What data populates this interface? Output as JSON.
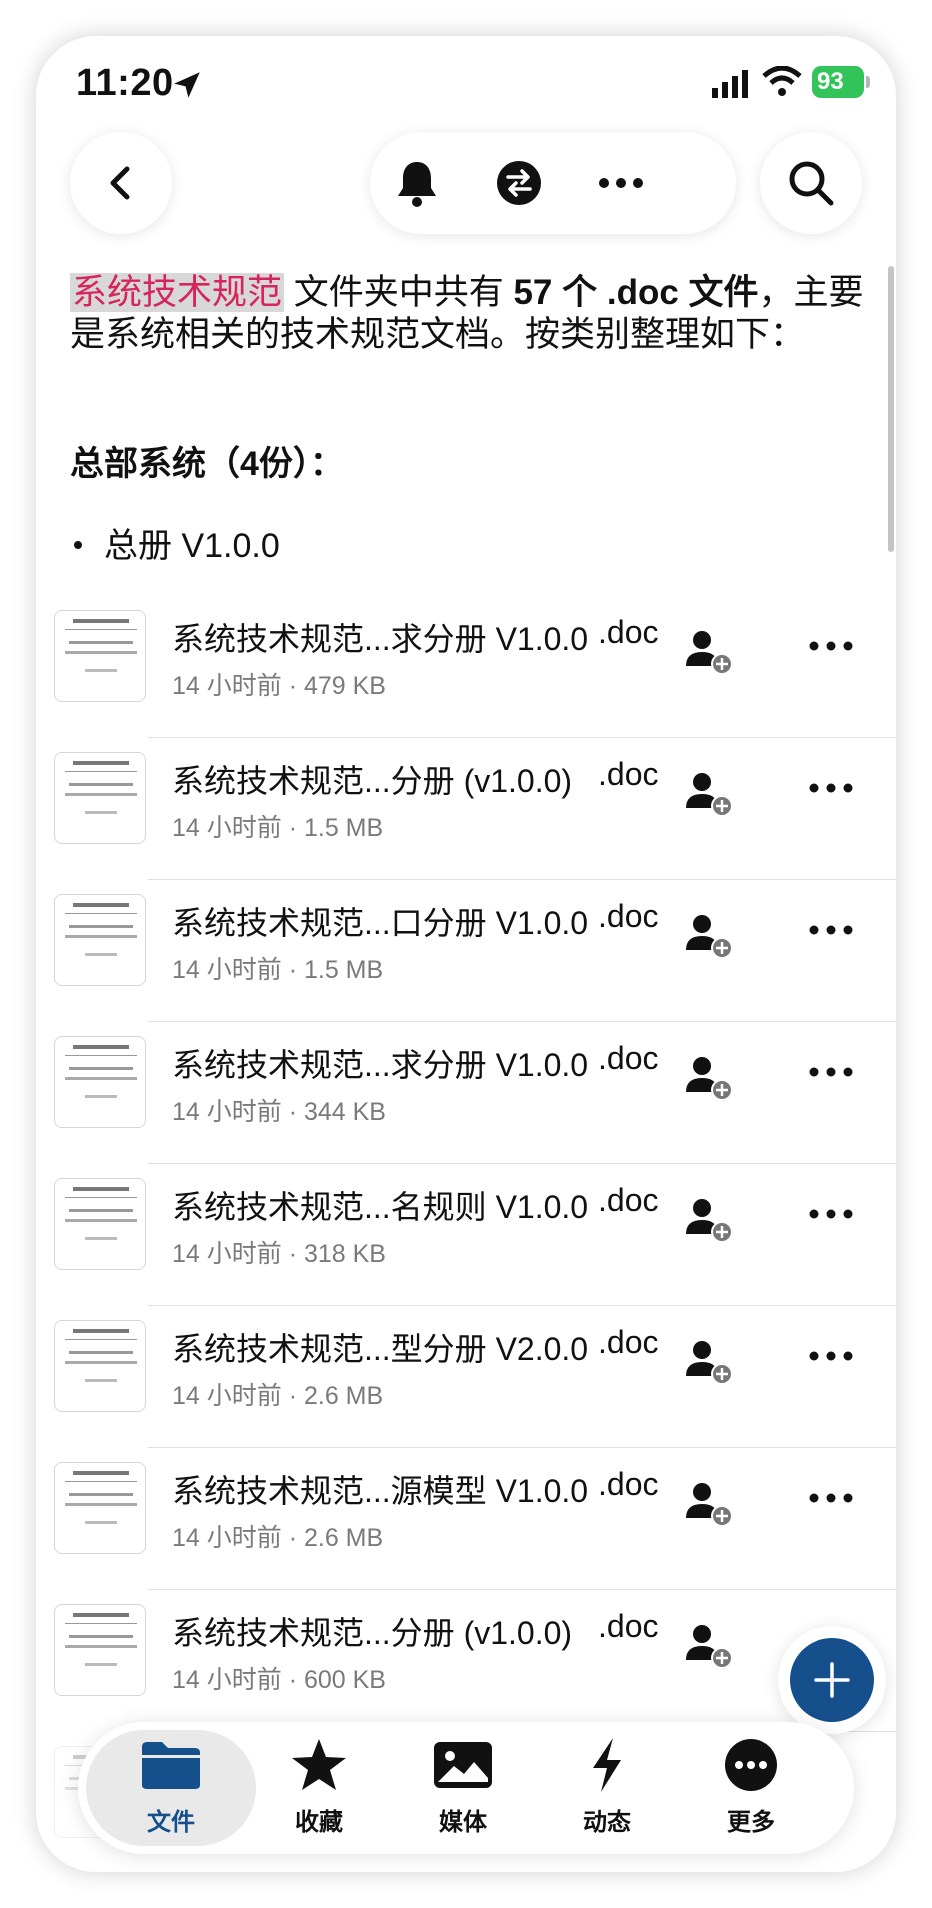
{
  "status_bar": {
    "time": "11:20",
    "battery": "93"
  },
  "colors": {
    "accent": "#154f8c",
    "highlight_text": "#d6245c",
    "battery_green": "#33c459"
  },
  "top_nav": {
    "back_icon": "chevron-left-icon",
    "actions": [
      "bell-icon",
      "swap-icon",
      "ellipsis-icon"
    ],
    "search_icon": "search-icon"
  },
  "summary": {
    "folder_name": "系统技术规范",
    "text1": " 文件夹中共有 ",
    "count": "57 个 .doc 文件",
    "text2": "，主要是系统相关的技术规范文档。按类别整理如下：",
    "section_title": "总部系统（4份）：",
    "bullet": "总册 V1.0.0"
  },
  "files": [
    {
      "name": "系统技术规范...求分册 V1.0.0",
      "ext": ".doc",
      "meta": "14 小时前 · 479 KB"
    },
    {
      "name": "系统技术规范...分册 (v1.0.0)",
      "ext": ".doc",
      "meta": "14 小时前 · 1.5 MB"
    },
    {
      "name": "系统技术规范...口分册 V1.0.0",
      "ext": ".doc",
      "meta": "14 小时前 · 1.5 MB"
    },
    {
      "name": "系统技术规范...求分册 V1.0.0",
      "ext": ".doc",
      "meta": "14 小时前 · 344 KB"
    },
    {
      "name": "系统技术规范...名规则 V1.0.0",
      "ext": ".doc",
      "meta": "14 小时前 · 318 KB"
    },
    {
      "name": "系统技术规范...型分册 V2.0.0",
      "ext": ".doc",
      "meta": "14 小时前 · 2.6 MB"
    },
    {
      "name": "系统技术规范...源模型 V1.0.0",
      "ext": ".doc",
      "meta": "14 小时前 · 2.6 MB"
    },
    {
      "name": "系统技术规范...分册 (v1.0.0)",
      "ext": ".doc",
      "meta": "14 小时前 · 600 KB"
    }
  ],
  "tabs": [
    {
      "label": "文件",
      "icon": "folder-icon",
      "active": true
    },
    {
      "label": "收藏",
      "icon": "star-icon"
    },
    {
      "label": "媒体",
      "icon": "image-icon"
    },
    {
      "label": "动态",
      "icon": "bolt-icon"
    },
    {
      "label": "更多",
      "icon": "more-circle-icon"
    }
  ]
}
